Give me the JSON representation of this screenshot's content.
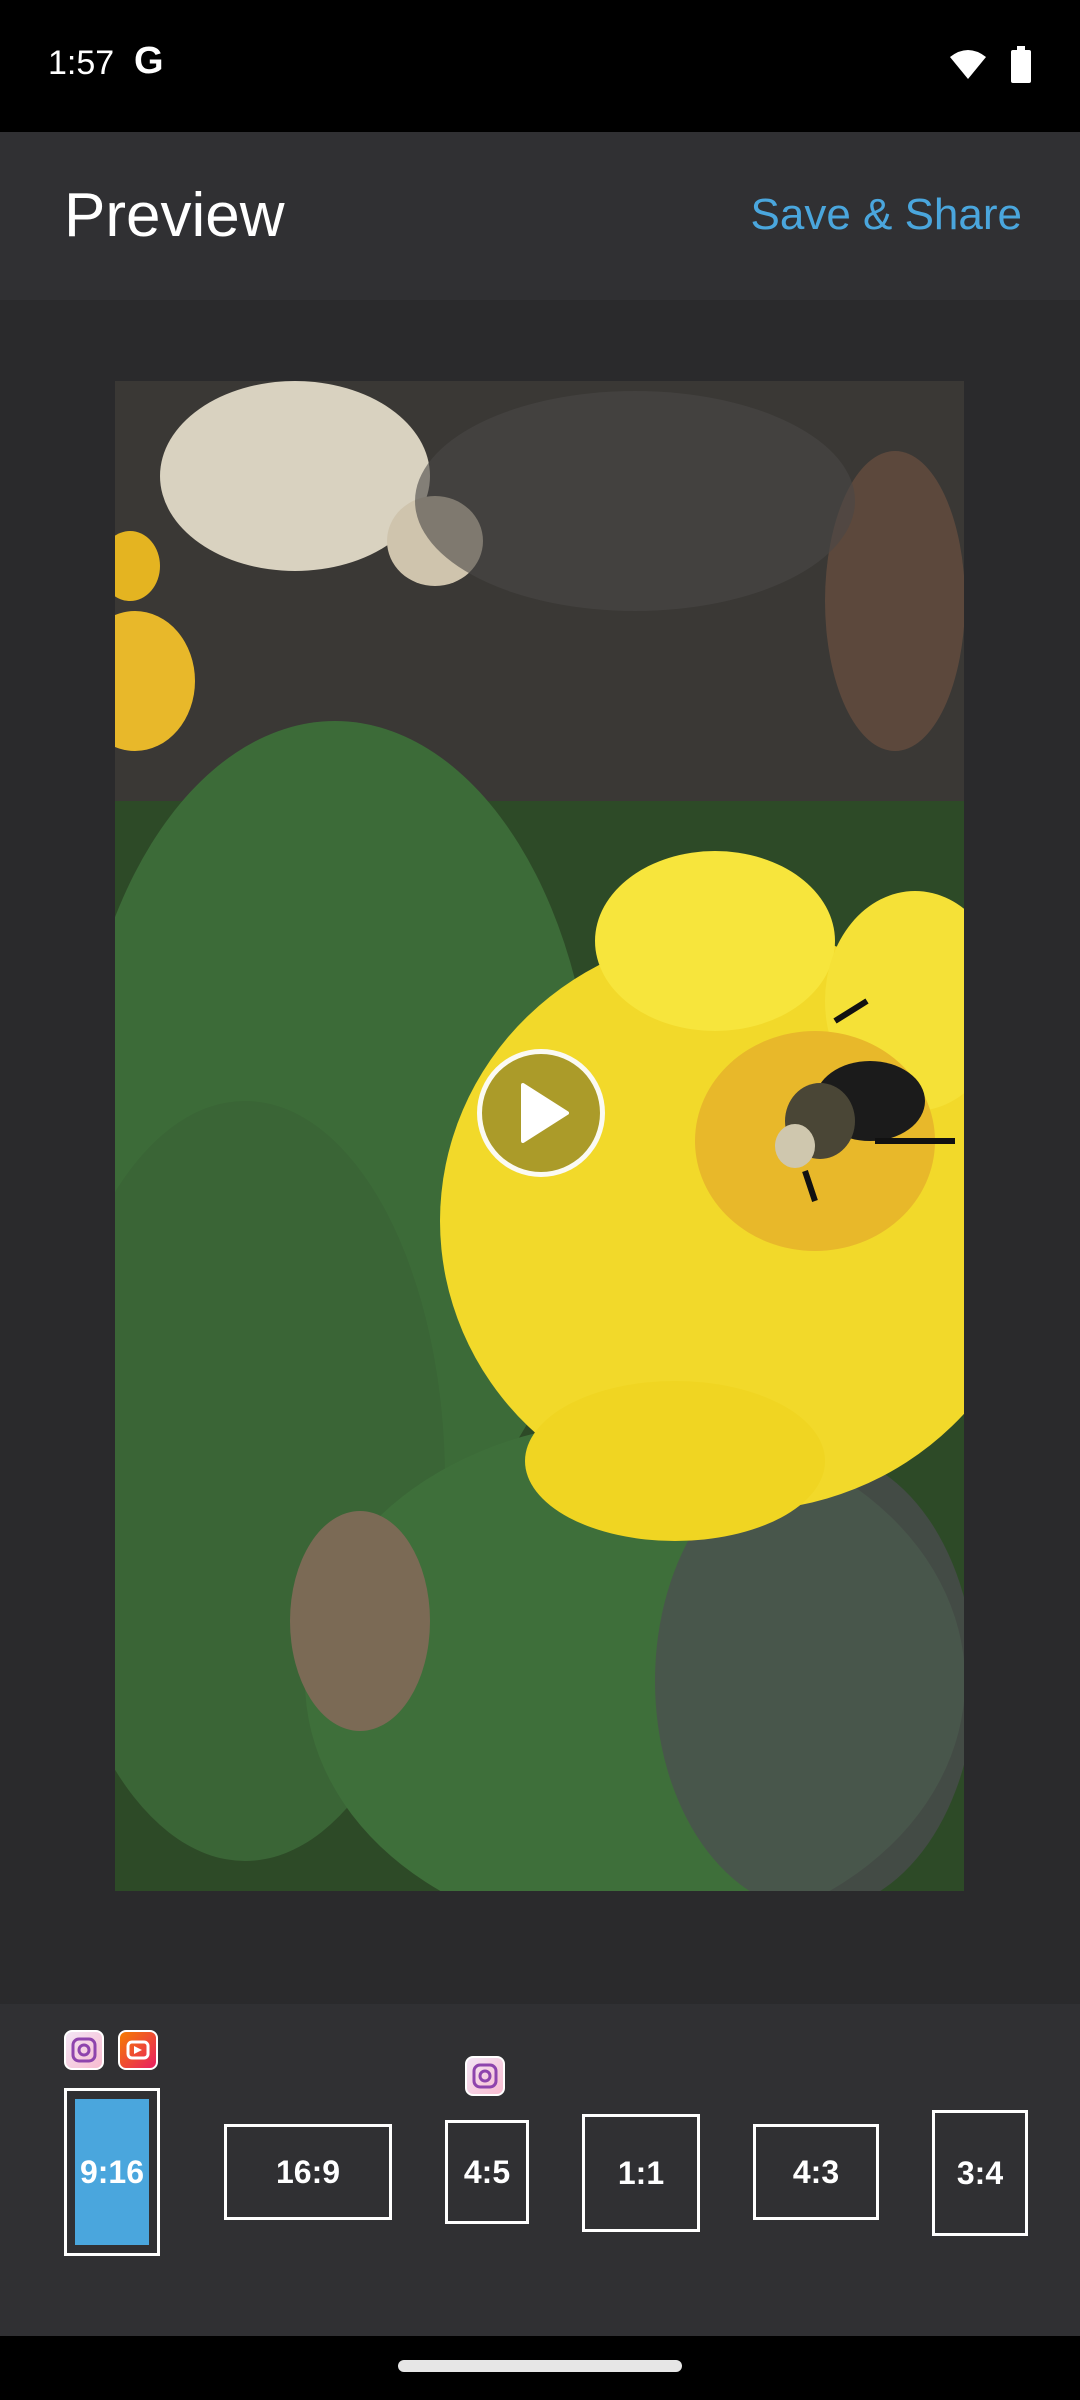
{
  "status_bar": {
    "time": "1:57",
    "g_label": "G",
    "icons": [
      "wifi-icon",
      "battery-icon"
    ]
  },
  "header": {
    "title": "Preview",
    "action_label": "Save & Share",
    "accent_color": "#4aa6dd"
  },
  "video": {
    "play_icon": "play-icon"
  },
  "aspect_ratios": {
    "options": [
      {
        "label": "9:16",
        "selected": true
      },
      {
        "label": "16:9",
        "selected": false
      },
      {
        "label": "4:5",
        "selected": false
      },
      {
        "label": "1:1",
        "selected": false
      },
      {
        "label": "4:3",
        "selected": false
      },
      {
        "label": "3:4",
        "selected": false
      }
    ],
    "badges": [
      "instagram-icon",
      "reels-icon",
      "instagram-icon"
    ]
  }
}
